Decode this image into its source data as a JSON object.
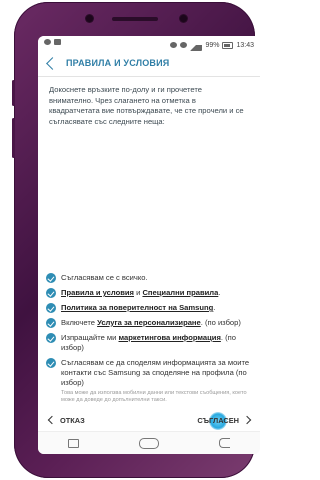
{
  "status_bar": {
    "battery": "99%",
    "time": "13:43"
  },
  "header": {
    "title": "ПРАВИЛА И УСЛОВИЯ"
  },
  "intro_text": "Докоснете връзките по-долу и ги прочетете внимателно. Чрез слагането на отметка в квадратчетата вие потвърждавате, че сте прочели и се съгласявате със следните неща:",
  "items": {
    "all": "Съгласявам се с всичко.",
    "terms_link": "Правила и условия",
    "terms_and": " и ",
    "special_link": "Специални правила",
    "terms_end": ".",
    "privacy_link": "Политика за поверителност на Samsung",
    "privacy_end": ".",
    "personal_pre": "Включете ",
    "personal_link": "Услуга за персонализиране",
    "personal_post": ". (по избор)",
    "marketing_pre": "Изпращайте ми ",
    "marketing_link": "маркетингова информация",
    "marketing_post": ". (по избор)",
    "share_text": "Съгласявам се да споделям информацията за моите контакти със Samsung за споделяне на профила (по избор)",
    "share_fine": "Това може да използва мобилни данни или текстови съобщения, което може да доведе до допълнителни такси."
  },
  "nav": {
    "back_label": "ОТКАЗ",
    "next_label": "СЪГЛАСЕН"
  }
}
